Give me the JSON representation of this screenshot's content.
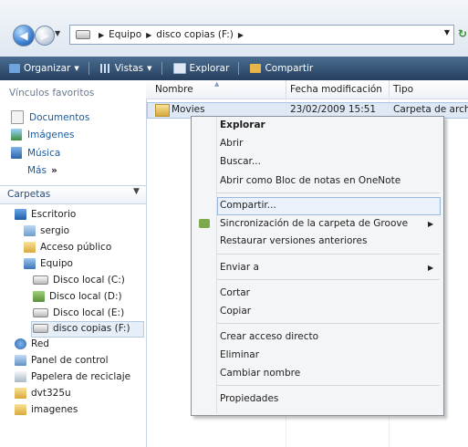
{
  "address": {
    "segments": [
      "Equipo",
      "disco copias (F:)"
    ]
  },
  "toolbar": {
    "organize": "Organizar",
    "views": "Vistas",
    "explore": "Explorar",
    "share": "Compartir"
  },
  "nav": {
    "favorites_header": "Vínculos favoritos",
    "favorites": [
      {
        "label": "Documentos",
        "icon": "documents-icon"
      },
      {
        "label": "Imágenes",
        "icon": "pictures-icon"
      },
      {
        "label": "Música",
        "icon": "music-icon"
      }
    ],
    "more": "Más",
    "folders_label": "Carpetas",
    "tree": [
      {
        "label": "Escritorio",
        "icon": "desktop-icon"
      },
      {
        "label": "sergio",
        "icon": "user-folder-icon"
      },
      {
        "label": "Acceso público",
        "icon": "public-folder-icon"
      },
      {
        "label": "Equipo",
        "icon": "computer-icon"
      },
      {
        "label": "Disco local (C:)",
        "icon": "drive-icon"
      },
      {
        "label": "Disco local (D:)",
        "icon": "drive-icon"
      },
      {
        "label": "Disco local (E:)",
        "icon": "drive-icon"
      },
      {
        "label": "disco copias (F:)",
        "icon": "drive-icon"
      },
      {
        "label": "Red",
        "icon": "network-icon"
      },
      {
        "label": "Panel de control",
        "icon": "control-panel-icon"
      },
      {
        "label": "Papelera de reciclaje",
        "icon": "recycle-bin-icon"
      },
      {
        "label": "dvt325u",
        "icon": "folder-icon"
      },
      {
        "label": "imagenes",
        "icon": "folder-icon"
      }
    ]
  },
  "columns": [
    "Nombre",
    "Fecha modificación",
    "Tipo"
  ],
  "file": {
    "name": "Movies",
    "date": "23/02/2009 15:51",
    "type": "Carpeta de archivos"
  },
  "context_menu": {
    "items": [
      "Explorar",
      "Abrir",
      "Buscar...",
      "Abrir como Bloc de notas en OneNote",
      "Compartir...",
      "Sincronización de la carpeta de Groove",
      "Restaurar versiones anteriores",
      "Enviar a",
      "Cortar",
      "Copiar",
      "Crear acceso directo",
      "Eliminar",
      "Cambiar nombre",
      "Propiedades"
    ]
  },
  "colors": {
    "toolbar": "#2f4f72",
    "link": "#1a5a9c",
    "selection": "#dfe9f6"
  }
}
